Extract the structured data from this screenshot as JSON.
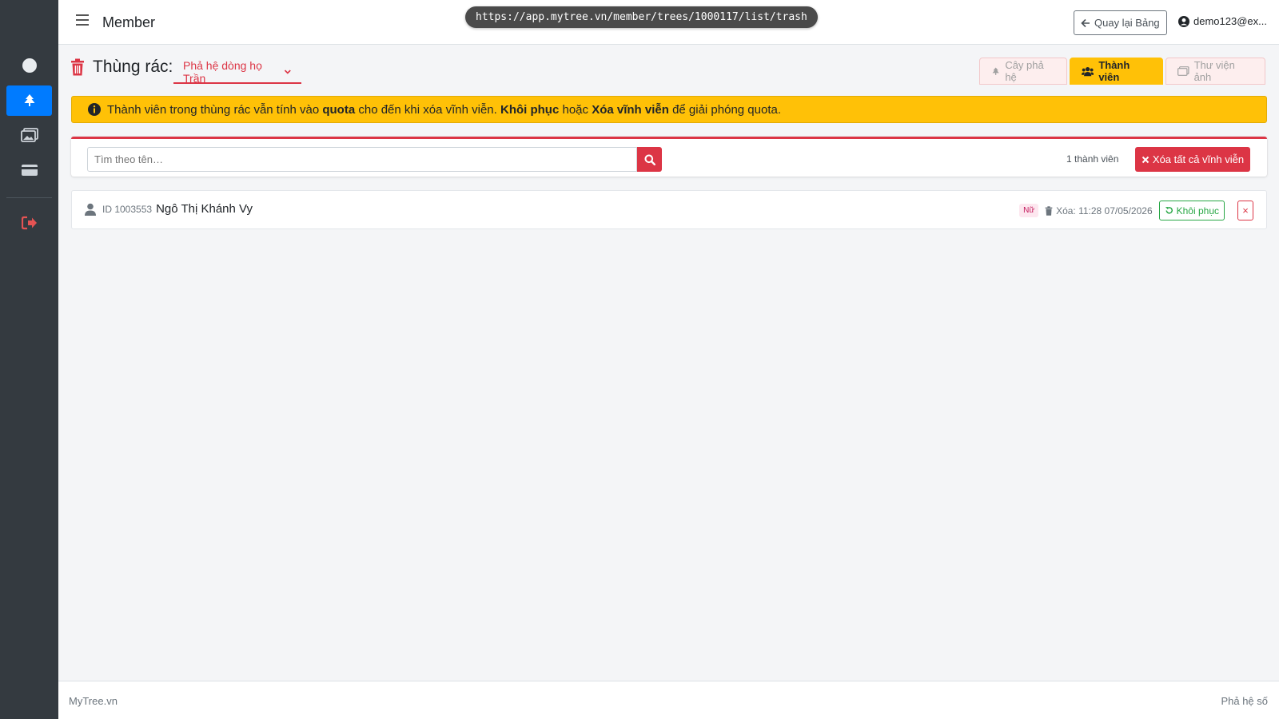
{
  "header": {
    "app_title": "Member",
    "url": "https://app.mytree.vn/member/trees/1000117/list/trash",
    "back_label": "Quay lại Bảng",
    "user_email": "demo123@ex..."
  },
  "sidebar": {
    "items": [
      {
        "icon": "circle-icon"
      },
      {
        "icon": "tree-icon",
        "active": true
      },
      {
        "icon": "gallery-icon"
      },
      {
        "icon": "card-icon"
      },
      {
        "icon": "logout-icon"
      }
    ]
  },
  "page": {
    "title": "Thùng rác:",
    "tree_select_value": "Phả hệ dòng họ Trần"
  },
  "tabs": [
    {
      "label": "Cây phả hệ",
      "icon": "tree-icon"
    },
    {
      "label": "Thành viên",
      "icon": "users-icon",
      "active": true
    },
    {
      "label": "Thư viện ảnh",
      "icon": "images-icon"
    }
  ],
  "alert": {
    "text_1": "Thành viên trong thùng rác vẫn tính vào",
    "bold_1": "quota",
    "text_2": "cho đến khi xóa vĩnh viễn.",
    "bold_2": "Khôi phục",
    "text_3": "hoặc",
    "bold_3": "Xóa vĩnh viễn",
    "text_4": "để giải phóng quota."
  },
  "search": {
    "placeholder": "Tìm theo tên…",
    "count_text": "1 thành viên",
    "delete_all_label": "Xóa tất cả vĩnh viễn"
  },
  "members": [
    {
      "id_label": "ID 1003553",
      "name": "Ngô Thị Khánh Vy",
      "gender": "Nữ",
      "deleted_at": "Xóa: 11:28 07/05/2026",
      "restore_label": "Khôi phục",
      "delete_label": "×"
    }
  ],
  "footer": {
    "left": "MyTree.vn",
    "right": "Phả hệ số"
  },
  "colors": {
    "sidebar": "#343a40",
    "primary": "#007bff",
    "danger": "#dc3545",
    "warning": "#ffc107",
    "success": "#28a745"
  }
}
